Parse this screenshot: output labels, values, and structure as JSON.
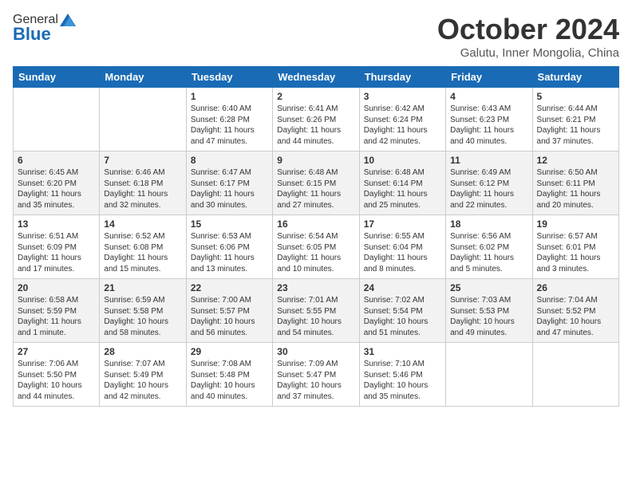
{
  "header": {
    "logo_general": "General",
    "logo_blue": "Blue",
    "month": "October 2024",
    "location": "Galutu, Inner Mongolia, China"
  },
  "days_of_week": [
    "Sunday",
    "Monday",
    "Tuesday",
    "Wednesday",
    "Thursday",
    "Friday",
    "Saturday"
  ],
  "weeks": [
    [
      {
        "day": "",
        "empty": true
      },
      {
        "day": "",
        "empty": true
      },
      {
        "day": "1",
        "sunrise": "6:40 AM",
        "sunset": "6:28 PM",
        "daylight": "11 hours and 47 minutes."
      },
      {
        "day": "2",
        "sunrise": "6:41 AM",
        "sunset": "6:26 PM",
        "daylight": "11 hours and 44 minutes."
      },
      {
        "day": "3",
        "sunrise": "6:42 AM",
        "sunset": "6:24 PM",
        "daylight": "11 hours and 42 minutes."
      },
      {
        "day": "4",
        "sunrise": "6:43 AM",
        "sunset": "6:23 PM",
        "daylight": "11 hours and 40 minutes."
      },
      {
        "day": "5",
        "sunrise": "6:44 AM",
        "sunset": "6:21 PM",
        "daylight": "11 hours and 37 minutes."
      }
    ],
    [
      {
        "day": "6",
        "sunrise": "6:45 AM",
        "sunset": "6:20 PM",
        "daylight": "11 hours and 35 minutes."
      },
      {
        "day": "7",
        "sunrise": "6:46 AM",
        "sunset": "6:18 PM",
        "daylight": "11 hours and 32 minutes."
      },
      {
        "day": "8",
        "sunrise": "6:47 AM",
        "sunset": "6:17 PM",
        "daylight": "11 hours and 30 minutes."
      },
      {
        "day": "9",
        "sunrise": "6:48 AM",
        "sunset": "6:15 PM",
        "daylight": "11 hours and 27 minutes."
      },
      {
        "day": "10",
        "sunrise": "6:48 AM",
        "sunset": "6:14 PM",
        "daylight": "11 hours and 25 minutes."
      },
      {
        "day": "11",
        "sunrise": "6:49 AM",
        "sunset": "6:12 PM",
        "daylight": "11 hours and 22 minutes."
      },
      {
        "day": "12",
        "sunrise": "6:50 AM",
        "sunset": "6:11 PM",
        "daylight": "11 hours and 20 minutes."
      }
    ],
    [
      {
        "day": "13",
        "sunrise": "6:51 AM",
        "sunset": "6:09 PM",
        "daylight": "11 hours and 17 minutes."
      },
      {
        "day": "14",
        "sunrise": "6:52 AM",
        "sunset": "6:08 PM",
        "daylight": "11 hours and 15 minutes."
      },
      {
        "day": "15",
        "sunrise": "6:53 AM",
        "sunset": "6:06 PM",
        "daylight": "11 hours and 13 minutes."
      },
      {
        "day": "16",
        "sunrise": "6:54 AM",
        "sunset": "6:05 PM",
        "daylight": "11 hours and 10 minutes."
      },
      {
        "day": "17",
        "sunrise": "6:55 AM",
        "sunset": "6:04 PM",
        "daylight": "11 hours and 8 minutes."
      },
      {
        "day": "18",
        "sunrise": "6:56 AM",
        "sunset": "6:02 PM",
        "daylight": "11 hours and 5 minutes."
      },
      {
        "day": "19",
        "sunrise": "6:57 AM",
        "sunset": "6:01 PM",
        "daylight": "11 hours and 3 minutes."
      }
    ],
    [
      {
        "day": "20",
        "sunrise": "6:58 AM",
        "sunset": "5:59 PM",
        "daylight": "11 hours and 1 minute."
      },
      {
        "day": "21",
        "sunrise": "6:59 AM",
        "sunset": "5:58 PM",
        "daylight": "10 hours and 58 minutes."
      },
      {
        "day": "22",
        "sunrise": "7:00 AM",
        "sunset": "5:57 PM",
        "daylight": "10 hours and 56 minutes."
      },
      {
        "day": "23",
        "sunrise": "7:01 AM",
        "sunset": "5:55 PM",
        "daylight": "10 hours and 54 minutes."
      },
      {
        "day": "24",
        "sunrise": "7:02 AM",
        "sunset": "5:54 PM",
        "daylight": "10 hours and 51 minutes."
      },
      {
        "day": "25",
        "sunrise": "7:03 AM",
        "sunset": "5:53 PM",
        "daylight": "10 hours and 49 minutes."
      },
      {
        "day": "26",
        "sunrise": "7:04 AM",
        "sunset": "5:52 PM",
        "daylight": "10 hours and 47 minutes."
      }
    ],
    [
      {
        "day": "27",
        "sunrise": "7:06 AM",
        "sunset": "5:50 PM",
        "daylight": "10 hours and 44 minutes."
      },
      {
        "day": "28",
        "sunrise": "7:07 AM",
        "sunset": "5:49 PM",
        "daylight": "10 hours and 42 minutes."
      },
      {
        "day": "29",
        "sunrise": "7:08 AM",
        "sunset": "5:48 PM",
        "daylight": "10 hours and 40 minutes."
      },
      {
        "day": "30",
        "sunrise": "7:09 AM",
        "sunset": "5:47 PM",
        "daylight": "10 hours and 37 minutes."
      },
      {
        "day": "31",
        "sunrise": "7:10 AM",
        "sunset": "5:46 PM",
        "daylight": "10 hours and 35 minutes."
      },
      {
        "day": "",
        "empty": true
      },
      {
        "day": "",
        "empty": true
      }
    ]
  ],
  "labels": {
    "sunrise": "Sunrise:",
    "sunset": "Sunset:",
    "daylight": "Daylight:"
  }
}
